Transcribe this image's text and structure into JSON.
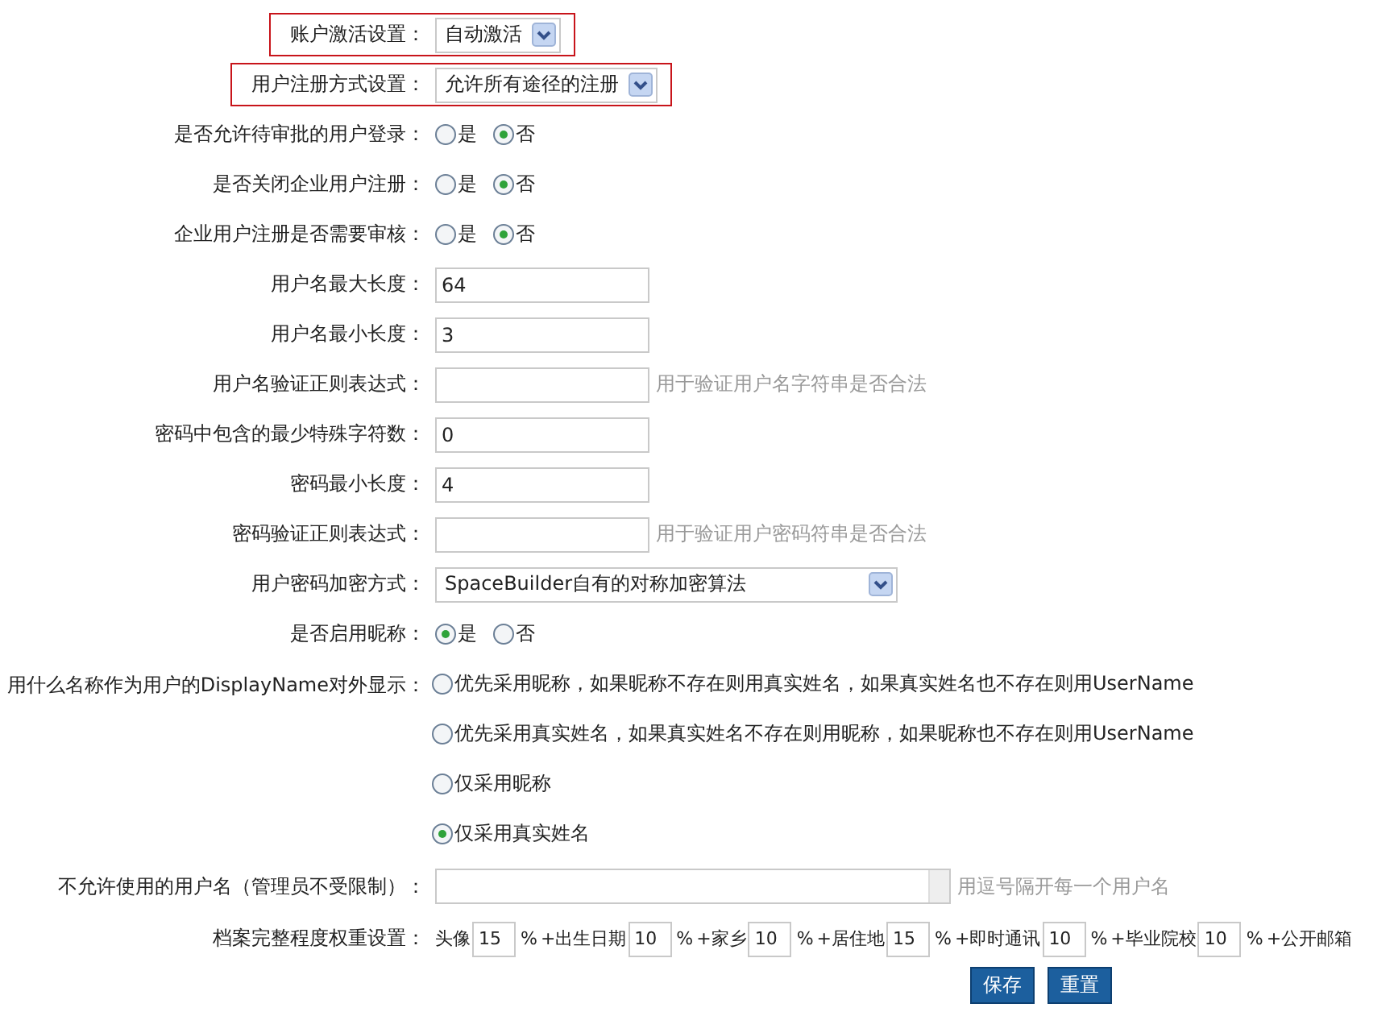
{
  "settings": [
    {
      "kind": "select",
      "label": "账户激活设置：",
      "value": "自动激活",
      "highlighted": true
    },
    {
      "kind": "select",
      "label": "用户注册方式设置：",
      "value": "允许所有途径的注册",
      "highlighted": true
    },
    {
      "kind": "radio",
      "label": "是否允许待审批的用户登录：",
      "options": [
        {
          "label": "是",
          "selected": false
        },
        {
          "label": "否",
          "selected": true
        }
      ]
    },
    {
      "kind": "radio",
      "label": "是否关闭企业用户注册：",
      "options": [
        {
          "label": "是",
          "selected": false
        },
        {
          "label": "否",
          "selected": true
        }
      ]
    },
    {
      "kind": "radio",
      "label": "企业用户注册是否需要审核：",
      "options": [
        {
          "label": "是",
          "selected": false
        },
        {
          "label": "否",
          "selected": true
        }
      ]
    },
    {
      "kind": "text",
      "label": "用户名最大长度：",
      "value": "64"
    },
    {
      "kind": "text",
      "label": "用户名最小长度：",
      "value": "3"
    },
    {
      "kind": "text",
      "label": "用户名验证正则表达式：",
      "hint": "用于验证用户名字符串是否合法"
    },
    {
      "kind": "text",
      "label": "密码中包含的最少特殊字符数：",
      "value": "0"
    },
    {
      "kind": "text",
      "label": "密码最小长度：",
      "value": "4"
    },
    {
      "kind": "text",
      "label": "密码验证正则表达式：",
      "hint": "用于验证用户密码符串是否合法"
    },
    {
      "kind": "select",
      "label": "用户密码加密方式：",
      "value": "SpaceBuilder自有的对称加密算法",
      "highlighted": false
    },
    {
      "kind": "radio",
      "label": "是否启用昵称：",
      "options": [
        {
          "label": "是",
          "selected": true
        },
        {
          "label": "否",
          "selected": false
        }
      ]
    },
    {
      "kind": "radio-list",
      "label": "用什么名称作为用户的DisplayName对外显示：",
      "options": [
        {
          "label": "优先采用昵称，如果昵称不存在则用真实姓名，如果真实姓名也不存在则用UserName",
          "selected": false
        },
        {
          "label": "优先采用真实姓名，如果真实姓名不存在则用昵称，如果昵称也不存在则用UserName",
          "selected": false
        },
        {
          "label": "仅采用昵称",
          "selected": false
        },
        {
          "label": "仅采用真实姓名",
          "selected": true
        }
      ]
    },
    {
      "kind": "textarea",
      "label": "不允许使用的用户名（管理员不受限制）：",
      "hint": "用逗号隔开每一个用户名"
    },
    {
      "kind": "weights",
      "label": "档案完整程度权重设置：",
      "items": [
        {
          "label": "头像",
          "value": "15",
          "unit": "%"
        },
        {
          "label": "+出生日期",
          "value": "10",
          "unit": "%"
        },
        {
          "label": "+家乡",
          "value": "10",
          "unit": "%"
        },
        {
          "label": "+居住地",
          "value": "15",
          "unit": "%"
        },
        {
          "label": "+即时通讯",
          "value": "10",
          "unit": "%"
        },
        {
          "label": "+毕业院校",
          "value": "10",
          "unit": "%"
        },
        {
          "label": "+公开邮箱"
        }
      ]
    }
  ],
  "buttons": [
    "保存",
    "重置"
  ]
}
